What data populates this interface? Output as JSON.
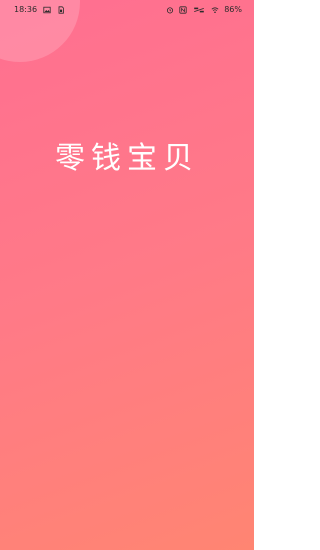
{
  "status_bar": {
    "time": "18:36",
    "left_icons": [
      "image-icon",
      "sim-icon"
    ],
    "right_icons": [
      "alarm-icon",
      "nfc-icon",
      "network-speed-icon",
      "wifi-icon"
    ],
    "battery_percent": "86%"
  },
  "splash": {
    "title": "零钱宝贝",
    "gradient_start": "#ff6f91",
    "gradient_end": "#ff8572"
  }
}
